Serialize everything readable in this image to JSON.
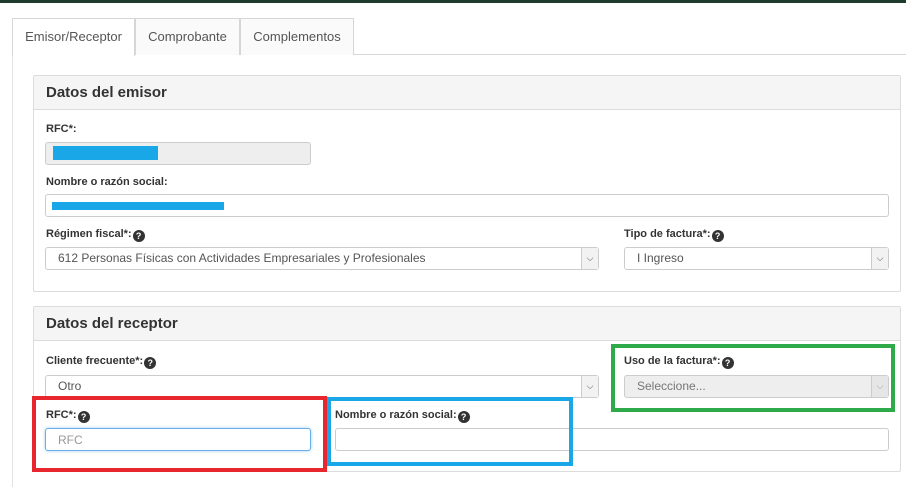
{
  "tabs": [
    {
      "label": "Emisor/Receptor",
      "active": true
    },
    {
      "label": "Comprobante",
      "active": false
    },
    {
      "label": "Complementos",
      "active": false
    }
  ],
  "emisor": {
    "heading": "Datos del emisor",
    "rfc_label": "RFC*:",
    "nombre_label": "Nombre o razón social:",
    "regimen_label": "Régimen fiscal*:",
    "regimen_value": "612 Personas Físicas con Actividades Empresariales y Profesionales",
    "tipo_label": "Tipo de factura*:",
    "tipo_value": "I Ingreso"
  },
  "receptor": {
    "heading": "Datos del receptor",
    "cliente_label": "Cliente frecuente*:",
    "cliente_value": "Otro",
    "uso_label": "Uso de la factura*:",
    "uso_value": "Seleccione...",
    "rfc_label": "RFC*:",
    "rfc_placeholder": "RFC",
    "nombre_label": "Nombre o razón social:",
    "nombre_value": ""
  },
  "icons": {
    "help": "question-circle-icon",
    "select_arrow": "chevron-down-icon"
  },
  "colors": {
    "redaction": "#1aa7e8",
    "annotation_red": "#e8262e",
    "annotation_blue": "#1aa7e8",
    "annotation_green": "#2eaa4a"
  }
}
